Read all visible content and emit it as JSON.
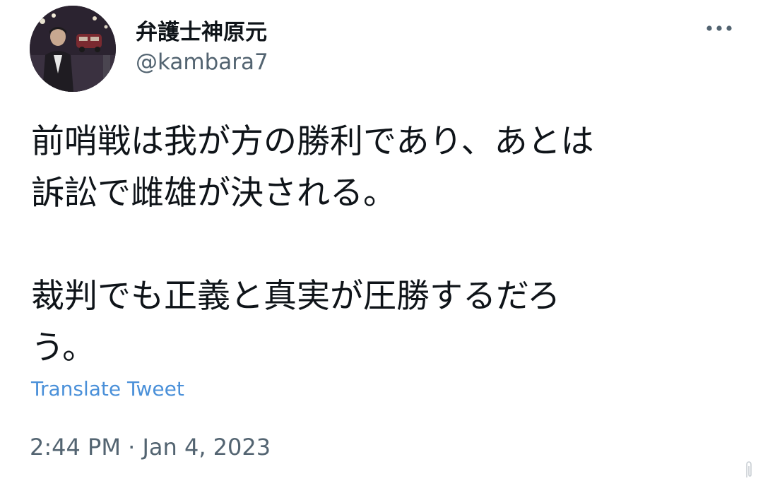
{
  "author": {
    "display_name": "弁護士神原元",
    "handle": "@kambara7",
    "avatar_icon": "profile-photo"
  },
  "more_icon": "more-horizontal-icon",
  "tweet": {
    "lines": [
      "前哨戦は我が方の勝利であり、あとは",
      "訴訟で雌雄が決される。",
      "",
      "裁判でも正義と真実が圧勝するだろ",
      "う。"
    ]
  },
  "translate_label": "Translate Tweet",
  "timestamp": "2:44 PM · Jan 4, 2023",
  "colors": {
    "text": "#0f1419",
    "secondary": "#536471",
    "link": "#4a90d9"
  }
}
